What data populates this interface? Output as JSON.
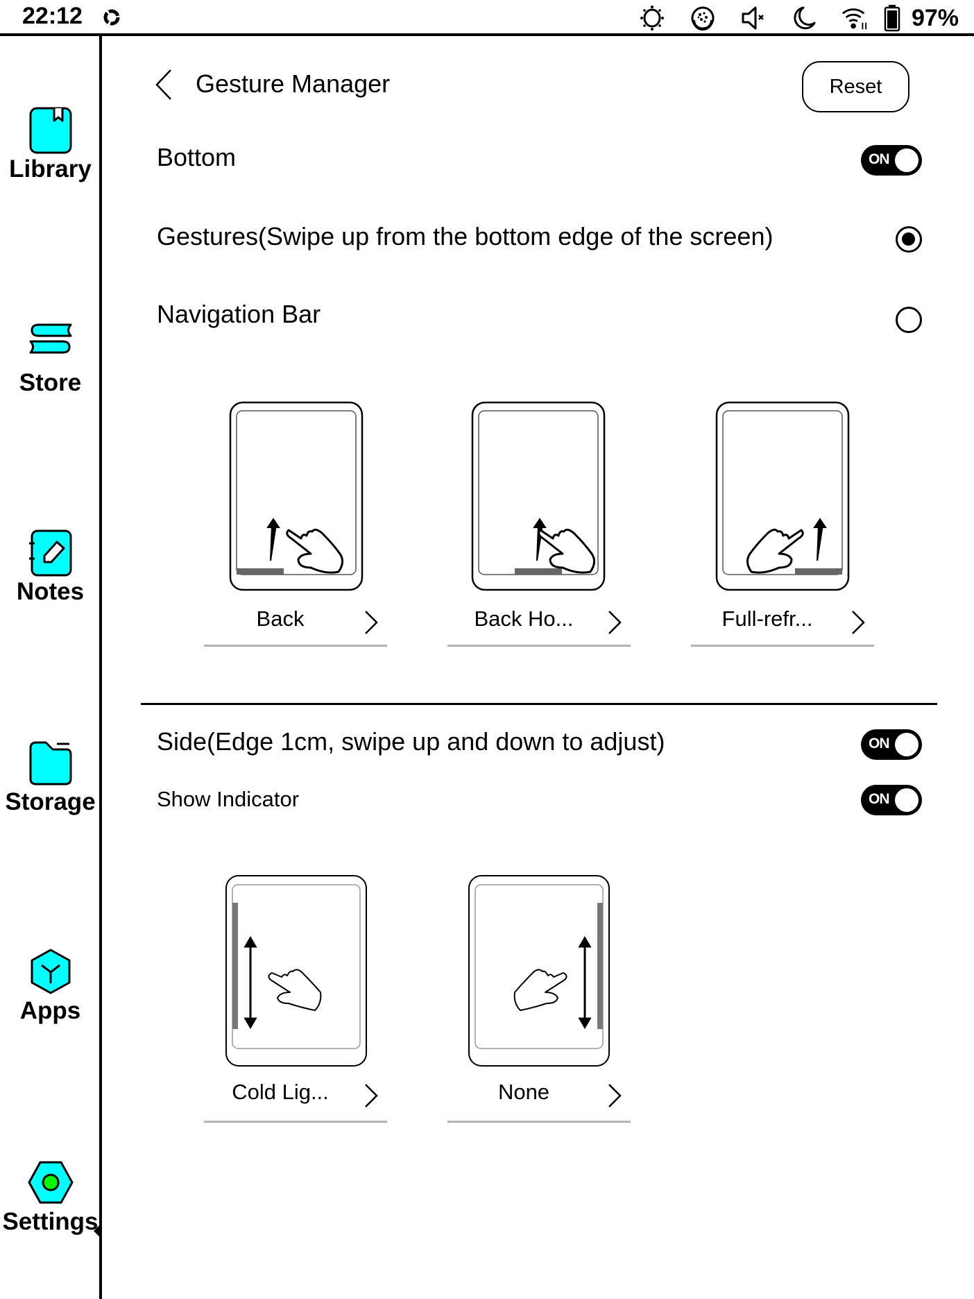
{
  "status_bar": {
    "time": "22:12",
    "sync_icon": "sync-icon",
    "icons": [
      "brightness-icon",
      "color-refresh-icon",
      "volume-muted-icon",
      "night-mode-icon",
      "wifi-icon",
      "battery-icon"
    ],
    "battery_percent": "97%"
  },
  "sidebar": {
    "items": [
      {
        "label": "Library",
        "icon": "library-book-icon",
        "active": false
      },
      {
        "label": "Store",
        "icon": "store-books-icon",
        "active": false
      },
      {
        "label": "Notes",
        "icon": "notes-pencil-icon",
        "active": false
      },
      {
        "label": "Storage",
        "icon": "storage-folder-icon",
        "active": false
      },
      {
        "label": "Apps",
        "icon": "apps-cube-icon",
        "active": false
      },
      {
        "label": "Settings",
        "icon": "settings-hex-icon",
        "active": true
      }
    ],
    "accent_color": "#00ffff",
    "settings_dot_color": "#00ff00"
  },
  "header": {
    "title": "Gesture Manager",
    "reset_label": "Reset"
  },
  "bottom_section": {
    "label": "Bottom",
    "toggle": "ON",
    "options": [
      {
        "label": "Gestures(Swipe up from the bottom edge of the screen)",
        "selected": true
      },
      {
        "label": "Navigation Bar",
        "selected": false
      }
    ],
    "cards": [
      {
        "label": "Back",
        "illustration": "swipe-up-bottom-left"
      },
      {
        "label": "Back Ho...",
        "illustration": "swipe-up-bottom-center"
      },
      {
        "label": "Full-refr...",
        "illustration": "swipe-up-bottom-right"
      }
    ]
  },
  "side_section": {
    "label": "Side(Edge 1cm, swipe up and down to adjust)",
    "toggle": "ON",
    "show_indicator_label": "Show Indicator",
    "show_indicator_toggle": "ON",
    "cards": [
      {
        "label": "Cold Lig...",
        "illustration": "swipe-vertical-left-edge"
      },
      {
        "label": "None",
        "illustration": "swipe-vertical-right-edge"
      }
    ]
  }
}
